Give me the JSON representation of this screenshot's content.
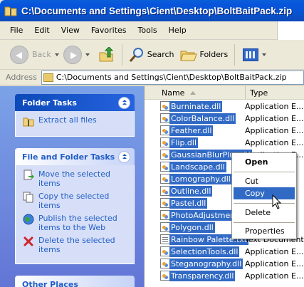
{
  "window": {
    "title": "C:\\Documents and Settings\\Cient\\Desktop\\BoltBaitPack.zip"
  },
  "menubar": {
    "items": [
      "File",
      "Edit",
      "View",
      "Favorites",
      "Tools",
      "Help"
    ]
  },
  "toolbar": {
    "back_label": "Back",
    "search_label": "Search",
    "folders_label": "Folders"
  },
  "address": {
    "label": "Address",
    "value": "C:\\Documents and Settings\\Cient\\Desktop\\BoltBaitPack.zip"
  },
  "taskpane": {
    "folder_tasks": {
      "title": "Folder Tasks",
      "items": [
        "Extract all files"
      ]
    },
    "file_folder_tasks": {
      "title": "File and Folder Tasks",
      "items": [
        "Move the selected items",
        "Copy the selected items",
        "Publish the selected items to the Web",
        "Delete the selected items"
      ]
    },
    "other_places": {
      "title": "Other Places"
    }
  },
  "filelist": {
    "columns": {
      "name": "Name",
      "type": "Type"
    },
    "rows": [
      {
        "name": "Burninate.dll",
        "type": "Application E...",
        "icon": "dll-file-icon"
      },
      {
        "name": "ColorBalance.dll",
        "type": "Application E...",
        "icon": "dll-file-icon"
      },
      {
        "name": "Feather.dll",
        "type": "Application E...",
        "icon": "dll-file-icon"
      },
      {
        "name": "Flip.dll",
        "type": "Application E...",
        "icon": "dll-file-icon"
      },
      {
        "name": "GaussianBlurPlus.dll",
        "type": "Application E...",
        "icon": "dll-file-icon"
      },
      {
        "name": "Landscape.dll",
        "type": "",
        "icon": "dll-file-icon"
      },
      {
        "name": "Lomography.dll",
        "type": "",
        "icon": "dll-file-icon"
      },
      {
        "name": "Outline.dll",
        "type": "",
        "icon": "dll-file-icon"
      },
      {
        "name": "Pastel.dll",
        "type": "",
        "icon": "dll-file-icon"
      },
      {
        "name": "PhotoAdjustment.dll",
        "type": "",
        "icon": "dll-file-icon"
      },
      {
        "name": "Polygon.dll",
        "type": "",
        "icon": "dll-file-icon"
      },
      {
        "name": "Rainbow Palette.txt",
        "type": "Text Document",
        "icon": "text-file-icon"
      },
      {
        "name": "SelectionTools.dll",
        "type": "Application E...",
        "icon": "dll-file-icon"
      },
      {
        "name": "Steganography.dll",
        "type": "Application E...",
        "icon": "dll-file-icon"
      },
      {
        "name": "Transparency.dll",
        "type": "Application E...",
        "icon": "dll-file-icon"
      }
    ]
  },
  "context_menu": {
    "items": [
      "Open",
      "Cut",
      "Copy",
      "Delete",
      "Properties"
    ],
    "highlighted": "Copy"
  },
  "colors": {
    "selection": "#316ac5",
    "titlebar": "#0855dd",
    "taskpane_bg": "#7ba2e7",
    "link": "#215dc6"
  }
}
